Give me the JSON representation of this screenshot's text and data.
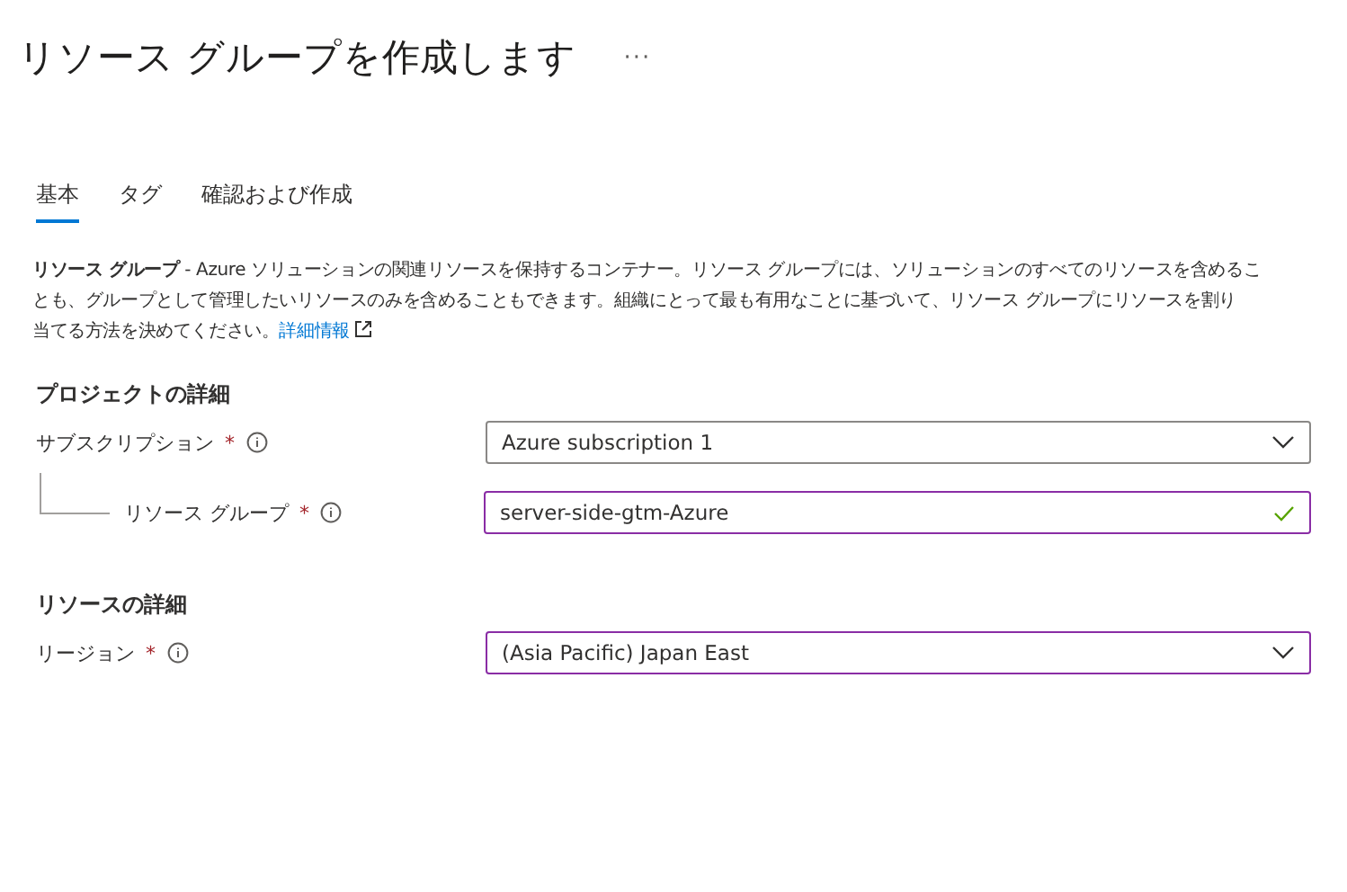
{
  "header": {
    "title": "リソース グループを作成します",
    "more": "···"
  },
  "tabs": [
    {
      "label": "基本",
      "selected": true
    },
    {
      "label": "タグ",
      "selected": false
    },
    {
      "label": "確認および作成",
      "selected": false
    }
  ],
  "description": {
    "lines": [
      "**リソース グループ** - Azure ソリューションの関連リソースを保持するコンテナー。リソース グループには、ソリューションのすべてのリソースを含めるこ",
      "とも、グループとして管理したいリソースのみを含めることもできます。組織にとって最も有用なことに基づいて、リソース グループにリソースを割り",
      "当てる方法を決めてください。"
    ],
    "link": "詳細情報"
  },
  "sections": [
    {
      "heading": "プロジェクトの詳細",
      "fields": [
        {
          "label": "サブスクリプション",
          "required_mark": "*",
          "kind": "dropdown",
          "value": "Azure subscription 1",
          "focused": false,
          "valid": false,
          "children": [
            {
              "label": "リソース グループ",
              "required_mark": "*",
              "kind": "text",
              "value": "server-side-gtm-Azure",
              "focused": true,
              "valid": true
            }
          ]
        }
      ]
    },
    {
      "heading": "リソースの詳細",
      "fields": [
        {
          "label": "リージョン",
          "required_mark": "*",
          "kind": "dropdown",
          "value": "(Asia Pacific) Japan East",
          "focused": true,
          "valid": false
        }
      ]
    }
  ]
}
